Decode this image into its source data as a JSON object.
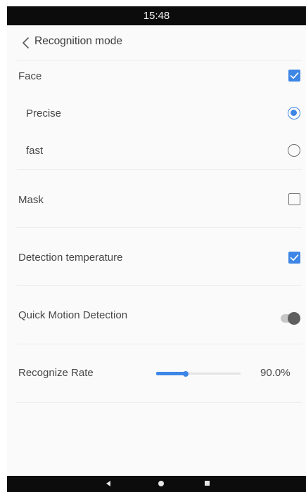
{
  "status_bar": {
    "time": "15:48"
  },
  "header": {
    "title": "Recognition mode",
    "back_icon": "chevron-left-icon"
  },
  "face": {
    "label": "Face",
    "checked": true
  },
  "precise": {
    "label": "Precise",
    "selected": true
  },
  "fast": {
    "label": "fast",
    "selected": false
  },
  "mask": {
    "label": "Mask",
    "checked": false
  },
  "temperature": {
    "label": "Detection temperature",
    "checked": true
  },
  "quick_motion": {
    "label": "Quick Motion Detection",
    "enabled": false
  },
  "rate": {
    "label": "Recognize Rate",
    "value_text": "90.0%",
    "slider_fraction": 0.35
  },
  "nav_bar": {
    "icons": [
      "back-triangle-icon",
      "home-circle-icon",
      "recents-square-icon"
    ]
  },
  "colors": {
    "accent": "#3d86e6",
    "bars": "#0c0c0c",
    "background": "#fafafa",
    "text": "#474747",
    "divider": "#ececec"
  }
}
